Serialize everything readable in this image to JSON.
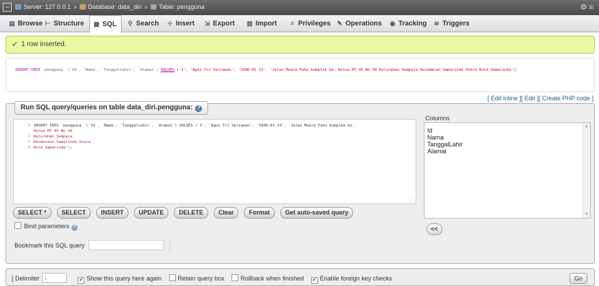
{
  "breadcrumb": {
    "server": "Server: 127.0.0.1",
    "database": "Database: data_diri",
    "table": "Table: pengguna"
  },
  "tabs": [
    {
      "label": "Browse",
      "icon": "browse-icon"
    },
    {
      "label": "Structure",
      "icon": "structure-icon"
    },
    {
      "label": "SQL",
      "icon": "sql-icon",
      "active": true
    },
    {
      "label": "Search",
      "icon": "search-icon"
    },
    {
      "label": "Insert",
      "icon": "insert-icon"
    },
    {
      "label": "Export",
      "icon": "export-icon"
    },
    {
      "label": "Import",
      "icon": "import-icon"
    },
    {
      "label": "Privileges",
      "icon": "privileges-icon"
    },
    {
      "label": "Operations",
      "icon": "operations-icon"
    },
    {
      "label": "Tracking",
      "icon": "tracking-icon"
    },
    {
      "label": "Triggers",
      "icon": "triggers-icon"
    }
  ],
  "success": {
    "message": "1 row inserted."
  },
  "sql_result": {
    "kw1": "INSERT INTO",
    "table": "`pengguna`",
    "cols": "(`Id`, `Nama`, `TanggalLahir`, `Alamat`)",
    "kw2": "VALUES",
    "values": "('1', 'Agus Tri Setiawan', '1996-01-13', 'Jalan Muara Pahu komplek Gn. Kelua RT 45 No 20 Kelurahan Sempaja Kecamatan Samarinda Utara Kota Samarinda');"
  },
  "links": {
    "edit_inline": "[ Edit inline ]",
    "edit": "[ Edit ]",
    "create_php": "[ Create PHP code ]"
  },
  "query_panel": {
    "legend": "Run SQL query/queries on table data_diri.pengguna:",
    "editor_lines": [
      {
        "n": "1",
        "text": "INSERT INTO `pengguna` (`Id`, `Nama`, `TanggalLahir`, `Alamat`) VALUES ('1', 'Agus Tri Setiawan', '1996-01-13', 'Jalan Muara Pahu komplek Gn."
      },
      {
        "n": "",
        "text": "Kelua RT 45 No 20"
      },
      {
        "n": "2",
        "text": "Kelurahan Sempaja"
      },
      {
        "n": "3",
        "text": "Kecamatan Samarinda Utara"
      },
      {
        "n": "4",
        "text": "Kota Samarinda');"
      }
    ],
    "columns_label": "Columns",
    "columns": [
      "Id",
      "Nama",
      "TanggalLahir",
      "Alamat"
    ],
    "buttons": [
      "SELECT *",
      "SELECT",
      "INSERT",
      "UPDATE",
      "DELETE",
      "Clear",
      "Format",
      "Get auto-saved query"
    ],
    "bind_parameters": "Bind parameters",
    "insert_column_button": "<<",
    "bookmark_label": "Bookmark this SQL query",
    "bookmark_value": ""
  },
  "bottom": {
    "delimiter_label": "[ Delimiter",
    "delimiter_value": ";",
    "show_query": "Show this query here again",
    "retain_box": "Retain query box",
    "rollback": "Rollback when finished",
    "foreign_keys": "Enable foreign key checks",
    "go": "Go"
  }
}
